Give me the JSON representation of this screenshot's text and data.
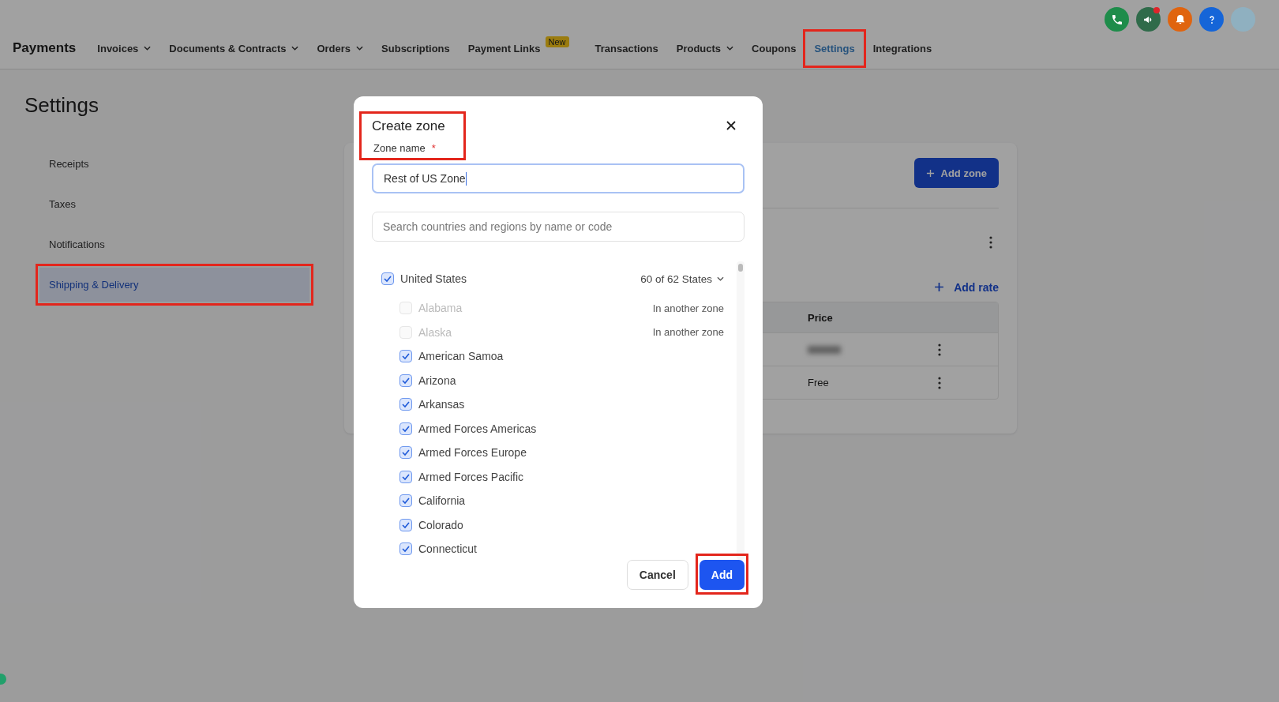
{
  "header": {
    "brand": "Payments",
    "nav": [
      {
        "label": "Invoices",
        "dropdown": true,
        "selected": false
      },
      {
        "label": "Documents & Contracts",
        "dropdown": true,
        "selected": false
      },
      {
        "label": "Orders",
        "dropdown": true,
        "selected": false
      },
      {
        "label": "Subscriptions",
        "dropdown": false,
        "selected": false
      },
      {
        "label": "Payment Links",
        "dropdown": false,
        "selected": false,
        "badge": "New"
      },
      {
        "label": "Transactions",
        "dropdown": false,
        "selected": false
      },
      {
        "label": "Products",
        "dropdown": true,
        "selected": false
      },
      {
        "label": "Coupons",
        "dropdown": false,
        "selected": false
      },
      {
        "label": "Settings",
        "dropdown": false,
        "selected": true,
        "annotated": true
      },
      {
        "label": "Integrations",
        "dropdown": false,
        "selected": false
      }
    ],
    "actions": [
      {
        "kind": "phone",
        "color": "#1e8c4a"
      },
      {
        "kind": "megaphone",
        "color": "#2f6b4a",
        "notification": true
      },
      {
        "kind": "bell",
        "color": "#e0640f"
      },
      {
        "kind": "help",
        "color": "#1565d8"
      },
      {
        "kind": "avatar",
        "color": "#8fb0c0"
      }
    ]
  },
  "page_title": "Settings",
  "sidebar": {
    "items": [
      {
        "label": "Receipts",
        "selected": false
      },
      {
        "label": "Taxes",
        "selected": false
      },
      {
        "label": "Notifications",
        "selected": false
      },
      {
        "label": "Shipping & Delivery",
        "selected": true,
        "annotated": true
      }
    ]
  },
  "zones_card": {
    "add_zone": "Add zone",
    "add_rate": "Add rate",
    "table": {
      "columns": [
        "Price"
      ],
      "rows": [
        {
          "price": "",
          "redacted": true
        },
        {
          "price": "Free",
          "redacted": false
        }
      ]
    }
  },
  "dialog": {
    "title": "Create zone",
    "title_annotated": true,
    "zone_name_label": "Zone name",
    "required_mark": "*",
    "zone_name_value": "Rest of US Zone",
    "search": {
      "placeholder": "Search countries and regions by name or code"
    },
    "country": {
      "label": "United States",
      "checked": true,
      "summary": "60 of 62 States",
      "expanded": true,
      "children": [
        {
          "label": "Alabama",
          "checked": false,
          "disabled": true,
          "note": "In another zone"
        },
        {
          "label": "Alaska",
          "checked": false,
          "disabled": true,
          "note": "In another zone"
        },
        {
          "label": "American Samoa",
          "checked": true,
          "disabled": false
        },
        {
          "label": "Arizona",
          "checked": true,
          "disabled": false
        },
        {
          "label": "Arkansas",
          "checked": true,
          "disabled": false
        },
        {
          "label": "Armed Forces Americas",
          "checked": true,
          "disabled": false
        },
        {
          "label": "Armed Forces Europe",
          "checked": true,
          "disabled": false
        },
        {
          "label": "Armed Forces Pacific",
          "checked": true,
          "disabled": false
        },
        {
          "label": "California",
          "checked": true,
          "disabled": false
        },
        {
          "label": "Colorado",
          "checked": true,
          "disabled": false
        },
        {
          "label": "Connecticut",
          "checked": true,
          "disabled": false
        }
      ]
    },
    "buttons": [
      {
        "kind": "secondary",
        "label": "Cancel"
      },
      {
        "kind": "primary",
        "label": "Add",
        "annotated": true
      }
    ]
  }
}
